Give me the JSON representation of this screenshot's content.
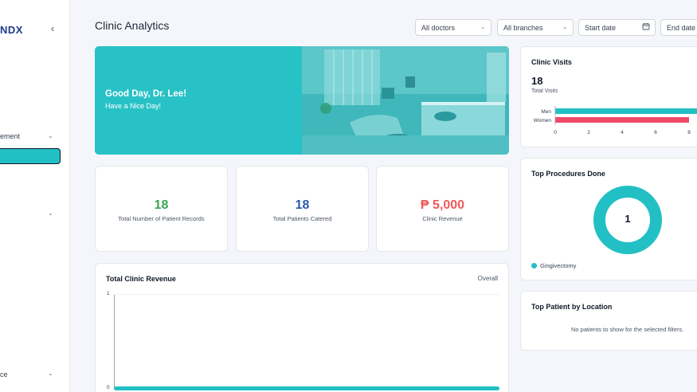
{
  "sidebar": {
    "logo": "NDX",
    "items": [
      {
        "label": "ement"
      },
      {
        "label": ""
      },
      {
        "label": "ce"
      }
    ]
  },
  "header": {
    "title": "Clinic Analytics",
    "filters": {
      "doctors": "All doctors",
      "branches": "All branches",
      "start_date": "Start date",
      "end_date": "End date"
    }
  },
  "hero": {
    "greeting": "Good Day, Dr. Lee!",
    "subtitle": "Have a Nice Day!"
  },
  "stats": [
    {
      "value": "18",
      "label": "Total Number of Patient Records",
      "color": "#3aa655"
    },
    {
      "value": "18",
      "label": "Total Patients Catered",
      "color": "#2a5aa8"
    },
    {
      "value": "₱ 5,000",
      "label": "Clinic Revenue",
      "color": "#ef5a5a"
    }
  ],
  "revenue": {
    "title": "Total Clinic Revenue",
    "period": "Overall",
    "y_ticks": [
      "1",
      "0"
    ]
  },
  "visits": {
    "title": "Clinic Visits",
    "total": "18",
    "total_label": "Total Visits",
    "x_ticks": [
      "0",
      "2",
      "4",
      "6",
      "8"
    ]
  },
  "procedures": {
    "title": "Top Procedures Done",
    "center_value": "1",
    "legend": "Gingivectomy"
  },
  "location": {
    "title": "Top Patient by Location",
    "empty": "No patients to show for the selected filters."
  },
  "chart_data": [
    {
      "type": "bar",
      "orientation": "horizontal",
      "title": "Clinic Visits",
      "categories": [
        "Men",
        "Women"
      ],
      "values": [
        10,
        8
      ],
      "colors": [
        "#22c0c4",
        "#ef4a6a"
      ],
      "xlim": [
        0,
        10
      ]
    },
    {
      "type": "pie",
      "title": "Top Procedures Done",
      "categories": [
        "Gingivectomy"
      ],
      "values": [
        1
      ],
      "colors": [
        "#22c0c4"
      ]
    },
    {
      "type": "area",
      "title": "Total Clinic Revenue",
      "ylim": [
        0,
        1
      ],
      "values": [
        0
      ],
      "colors": [
        "#22c0c4"
      ]
    }
  ]
}
